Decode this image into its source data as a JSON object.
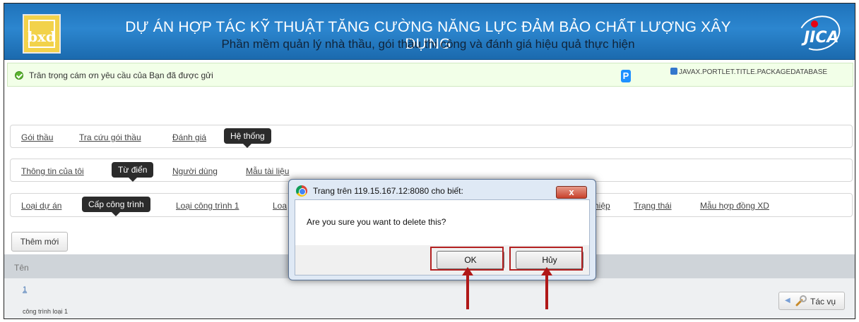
{
  "banner": {
    "logo_text": "bxd",
    "title": "DỰ ÁN HỢP TÁC KỸ THUẬT TĂNG CƯỜNG NĂNG LỰC ĐẢM BẢO CHẤT LƯỢNG XÂY DỰNG",
    "subtitle": "Phần mềm quản lý nhà thầu, gói thầu thi công và đánh giá hiệu quả thực hiện",
    "jica_text": "JICA"
  },
  "message": {
    "text": "Trân trọng cám ơn yêu cầu của Bạn đã được gửi",
    "p_icon": "P",
    "portlet_title": "JAVAX.PORTLET.TITLE.PACKAGEDATABASE"
  },
  "nav1": {
    "items": [
      "Gói thầu",
      "Tra cứu gói thầu",
      "Đánh giá",
      "Hệ thống"
    ],
    "active": "Hệ thống"
  },
  "nav2": {
    "items": [
      "Thông tin của tôi",
      "Từ điển",
      "Người dùng",
      "Mẫu tài liệu"
    ],
    "active": "Từ điển"
  },
  "nav3": {
    "items": [
      "Loại dự án",
      "Cấp công trình",
      "Loại công trình 1",
      "Loa",
      "hiệp",
      "Trạng thái",
      "Mẫu hợp đồng XD"
    ],
    "active": "Cấp công trình"
  },
  "add_button": "Thêm mới",
  "grid": {
    "header": "Tên",
    "rows": [
      {
        "number": "1",
        "name": "công trình loại 1"
      }
    ],
    "actions_label": "Tác vụ"
  },
  "dialog": {
    "title": "Trang trên 119.15.167.12:8080 cho biết:",
    "close": "x",
    "message": "Are you sure you want to delete this?",
    "ok": "OK",
    "cancel": "Hủy"
  },
  "colors": {
    "banner": "#2c86cf",
    "active_tab": "#2b2b2b",
    "annotation": "#b32020",
    "success": "#5cb531"
  },
  "icons": [
    "success-check-icon",
    "portlet-p-icon",
    "chrome-icon",
    "wrench-icon",
    "close-icon"
  ]
}
